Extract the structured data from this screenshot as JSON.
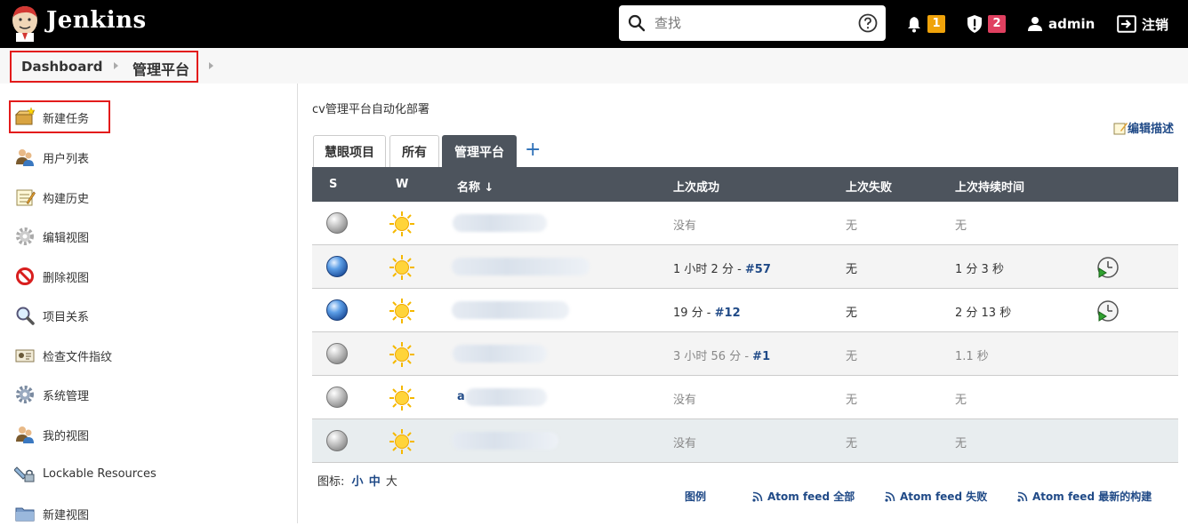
{
  "header": {
    "brand": "Jenkins",
    "search_placeholder": "查找",
    "notifications_count": "1",
    "security_count": "2",
    "user": "admin",
    "logout": "注销"
  },
  "breadcrumb": {
    "items": [
      "Dashboard",
      "管理平台"
    ]
  },
  "sidebar": {
    "items": [
      {
        "label": "新建任务",
        "icon": "new-item-icon"
      },
      {
        "label": "用户列表",
        "icon": "users-icon"
      },
      {
        "label": "构建历史",
        "icon": "notepad-icon"
      },
      {
        "label": "编辑视图",
        "icon": "gear-icon"
      },
      {
        "label": "删除视图",
        "icon": "no-icon"
      },
      {
        "label": "项目关系",
        "icon": "magnifier-icon"
      },
      {
        "label": "检查文件指纹",
        "icon": "fingerprint-icon"
      },
      {
        "label": "系统管理",
        "icon": "gear-icon"
      },
      {
        "label": "我的视图",
        "icon": "user-icon"
      },
      {
        "label": "Lockable Resources",
        "icon": "lock-resources-icon"
      },
      {
        "label": "新建视图",
        "icon": "folder-icon"
      }
    ]
  },
  "main": {
    "description": "cv管理平台自动化部署",
    "edit_description": "编辑描述",
    "tabs": [
      {
        "label": "慧眼项目",
        "active": false
      },
      {
        "label": "所有",
        "active": false
      },
      {
        "label": "管理平台",
        "active": true
      }
    ],
    "add_tab": "+",
    "columns": [
      "S",
      "W",
      "名称 ↓",
      "上次成功",
      "上次失败",
      "上次持续时间"
    ],
    "rows": [
      {
        "status": "grey",
        "name_visible": "",
        "last_success": "没有",
        "build": "",
        "last_failure": "无",
        "duration": "无",
        "schedule": false
      },
      {
        "status": "blue",
        "name_visible": "",
        "last_success": "1 小时 2 分 - ",
        "build": "#57",
        "last_failure": "无",
        "duration": "1 分 3 秒",
        "schedule": true
      },
      {
        "status": "blue",
        "name_visible": "",
        "last_success": "19 分 - ",
        "build": "#12",
        "last_failure": "无",
        "duration": "2 分 13 秒",
        "schedule": true
      },
      {
        "status": "grey",
        "name_visible": "",
        "last_success": "3 小时 56 分 - ",
        "build": "#1",
        "last_failure": "无",
        "duration": "1.1 秒",
        "schedule": false
      },
      {
        "status": "grey",
        "name_visible": "a",
        "last_success": "没有",
        "build": "",
        "last_failure": "无",
        "duration": "无",
        "schedule": false
      },
      {
        "status": "grey",
        "name_visible": "",
        "last_success": "没有",
        "build": "",
        "last_failure": "无",
        "duration": "无",
        "schedule": false
      }
    ],
    "icon_size_label": "图标:",
    "icon_sizes": [
      "小",
      "中",
      "大"
    ],
    "footer_links": [
      "图例",
      "Atom feed 全部",
      "Atom feed 失败",
      "Atom feed 最新的构建"
    ]
  },
  "colors": {
    "header_bg": "#000000",
    "table_header_bg": "#4d545d",
    "link": "#204a87",
    "highlight_box": "#e31b1b",
    "badge_orange": "#f0a30a",
    "badge_red": "#e04060"
  }
}
